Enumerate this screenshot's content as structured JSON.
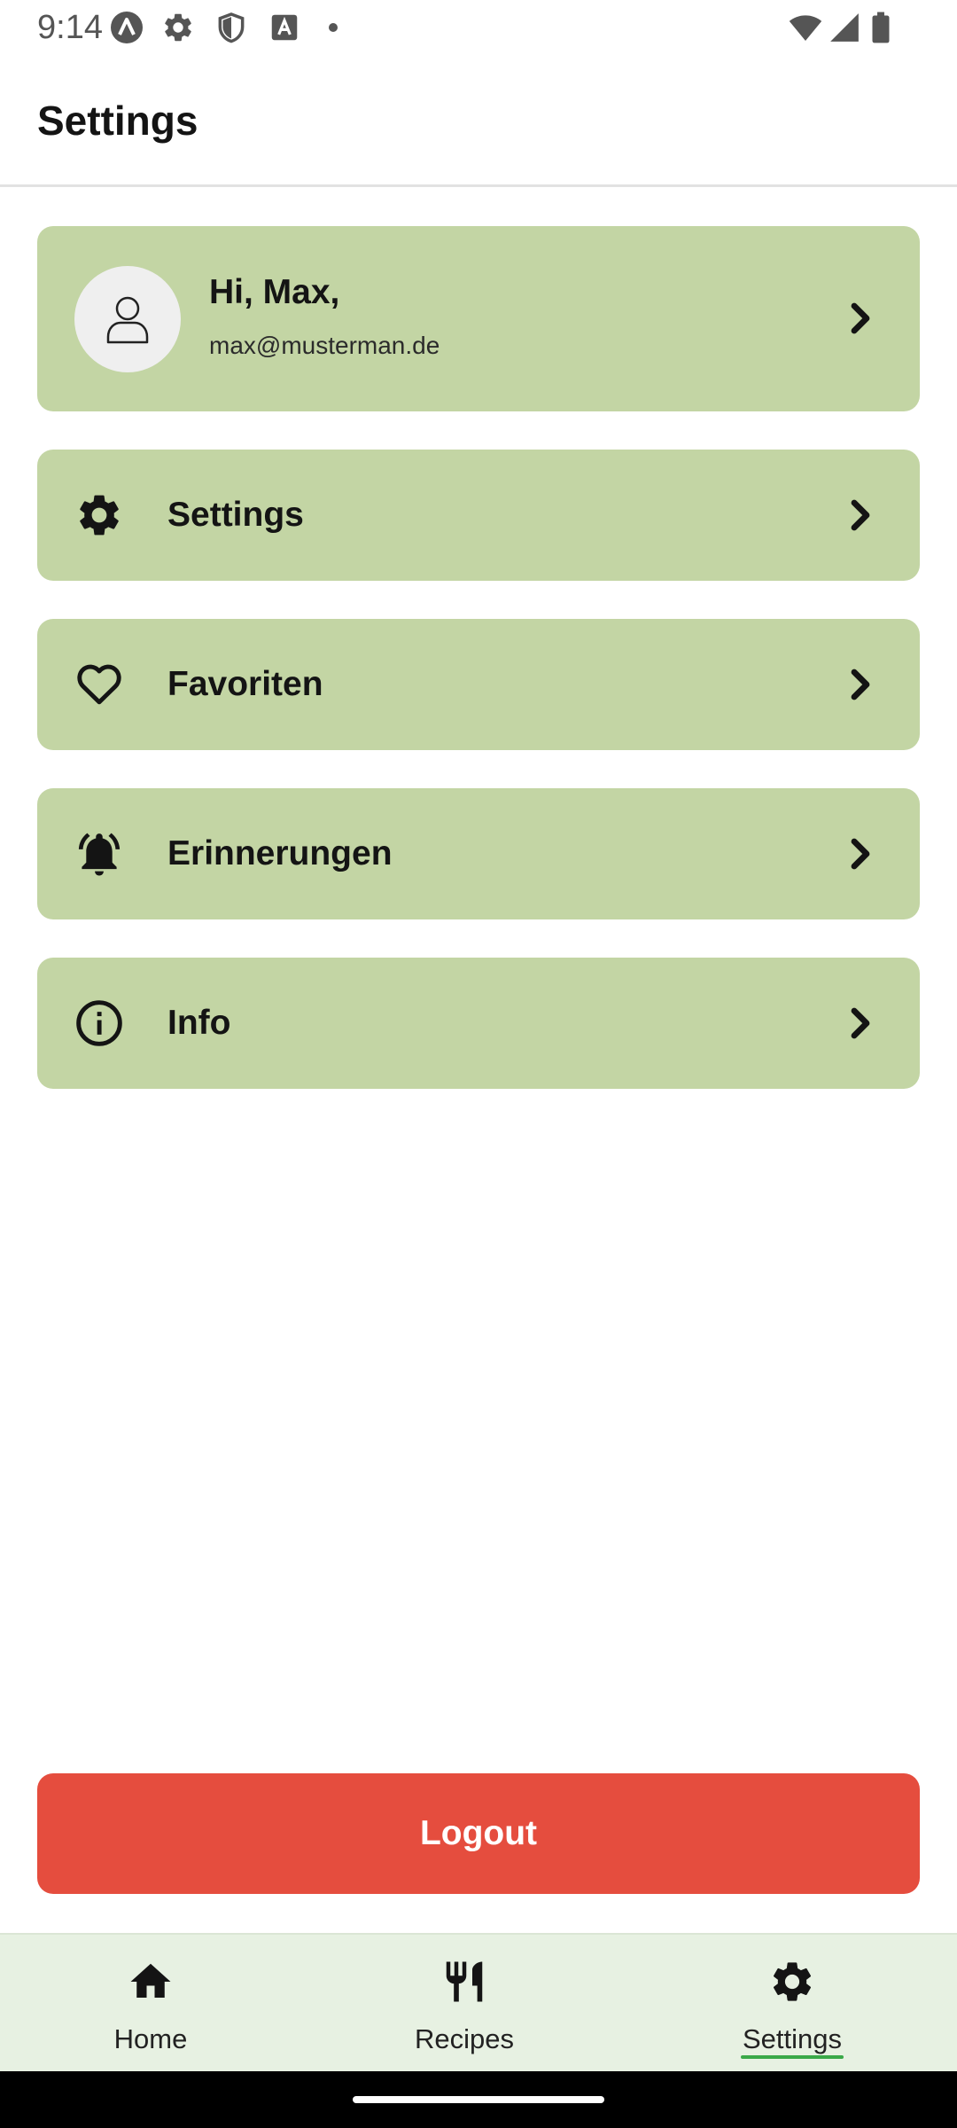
{
  "status_bar": {
    "time": "9:14",
    "icons": [
      "app-a-icon",
      "gear-icon",
      "shield-icon",
      "font-icon",
      "dot-icon",
      "wifi-icon",
      "signal-icon",
      "battery-icon"
    ]
  },
  "header": {
    "title": "Settings"
  },
  "profile": {
    "greeting": "Hi, Max,",
    "email": "max@musterman.de",
    "icon": "user-icon"
  },
  "menu": {
    "items": [
      {
        "label": "Settings",
        "icon": "gear-icon"
      },
      {
        "label": "Favoriten",
        "icon": "heart-icon"
      },
      {
        "label": "Erinnerungen",
        "icon": "bell-icon"
      },
      {
        "label": "Info",
        "icon": "info-icon"
      }
    ]
  },
  "logout": {
    "label": "Logout"
  },
  "bottom_nav": {
    "items": [
      {
        "label": "Home",
        "icon": "home-icon"
      },
      {
        "label": "Recipes",
        "icon": "fork-knife-icon"
      },
      {
        "label": "Settings",
        "icon": "gear-icon"
      }
    ],
    "active": "Settings"
  },
  "colors": {
    "card": "#c3d5a4",
    "logout": "#e54d3e",
    "nav_background": "#e7f1e2",
    "active_indicator": "#3aa948"
  }
}
